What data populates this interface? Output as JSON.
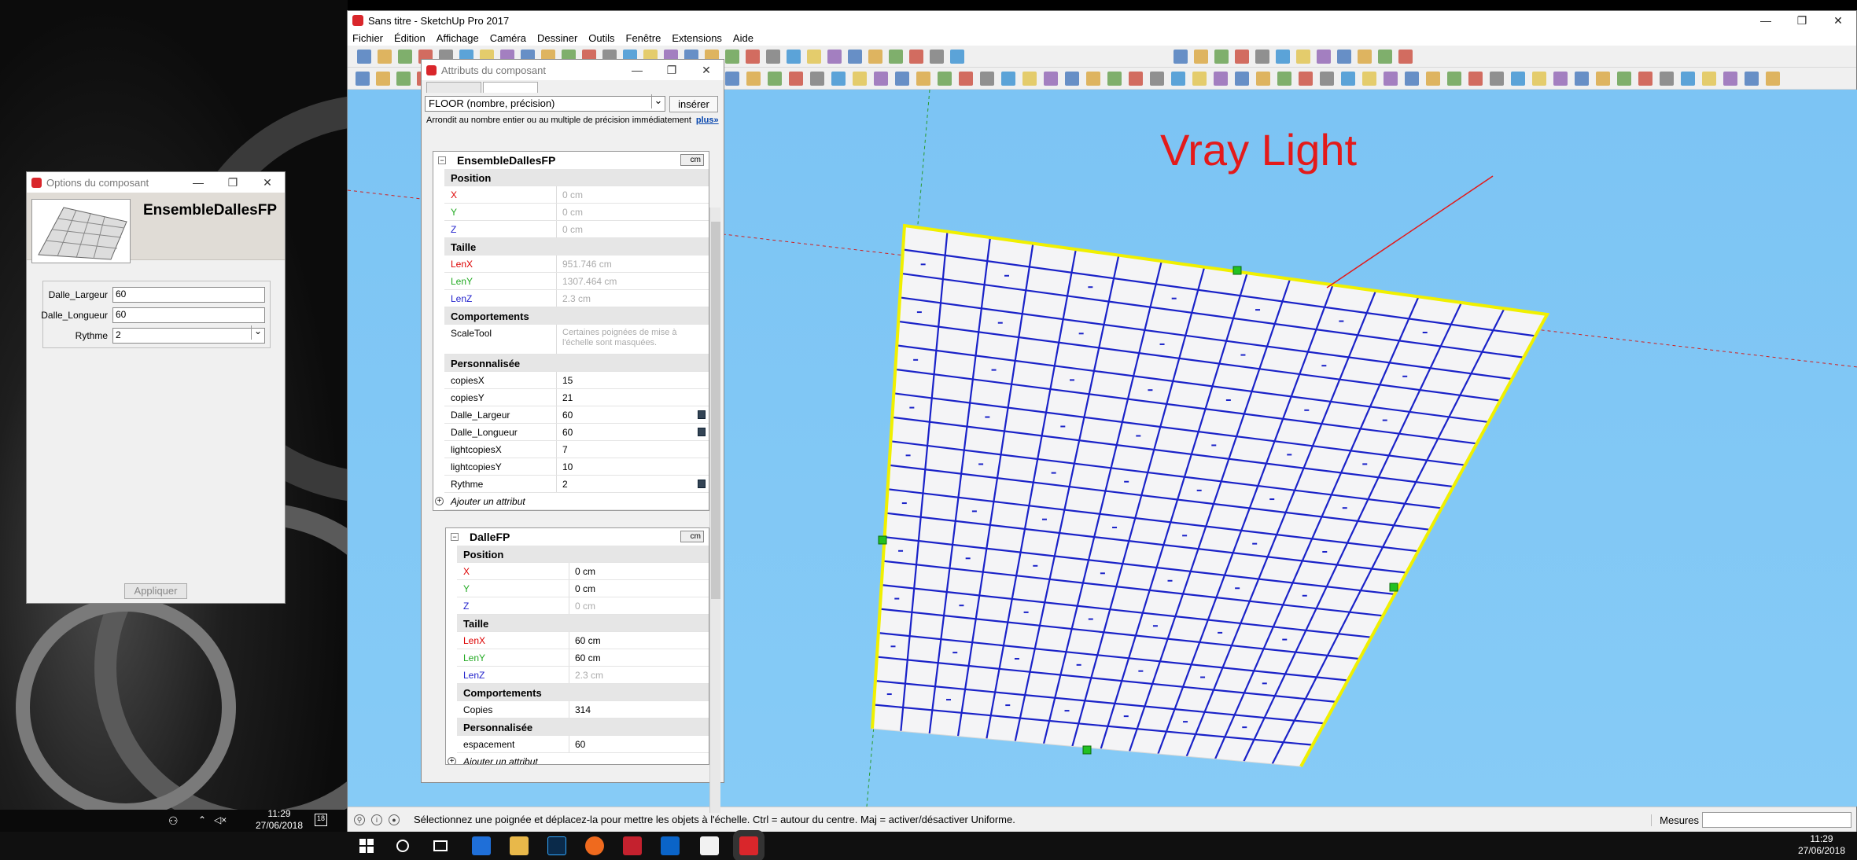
{
  "main_window": {
    "title": "Sans titre - SketchUp Pro 2017",
    "controls": {
      "minimize": "—",
      "restore": "❐",
      "close": "✕"
    },
    "menu": [
      "Fichier",
      "Édition",
      "Affichage",
      "Caméra",
      "Dessiner",
      "Outils",
      "Fenêtre",
      "Extensions",
      "Aide"
    ]
  },
  "viewport": {
    "annotation": "Vray Light",
    "colors": {
      "sky": "#7cc4f4",
      "floor": "#f4f4f6",
      "grid": "#1a22c8",
      "edge": "#f0f000",
      "red_axis": "#d02020",
      "green_axis": "#2a9a2a"
    }
  },
  "status_bar": {
    "message": "Sélectionnez une poignée et déplacez-la pour mettre les objets à l'échelle. Ctrl = autour du centre. Maj = activer/désactiver Uniforme.",
    "measure_label": "Mesures",
    "measure_value": ""
  },
  "options_dialog": {
    "title": "Options du composant",
    "component_name": "EnsembleDallesFP",
    "fields": [
      {
        "label": "Dalle_Largeur",
        "value": "60"
      },
      {
        "label": "Dalle_Longueur",
        "value": "60"
      },
      {
        "label": "Rythme",
        "value": "2"
      }
    ],
    "apply_label": "Appliquer"
  },
  "attributes_dialog": {
    "title": "Attributs du composant",
    "formula_select": "FLOOR (nombre, précision)",
    "insert_label": "insérer",
    "hint": "Arrondit au nombre entier ou au multiple de précision immédiatement",
    "hint_link": "plus»",
    "components": [
      {
        "name": "EnsembleDallesFP",
        "unit": "cm",
        "rows": [
          {
            "type": "section",
            "key": "Position"
          },
          {
            "key": "X",
            "value": "0 cm",
            "color": "red",
            "gray": true
          },
          {
            "key": "Y",
            "value": "0 cm",
            "color": "green",
            "gray": true
          },
          {
            "key": "Z",
            "value": "0 cm",
            "color": "blue",
            "gray": true
          },
          {
            "type": "section",
            "key": "Taille"
          },
          {
            "key": "LenX",
            "value": "951.746 cm",
            "color": "red",
            "gray": true
          },
          {
            "key": "LenY",
            "value": "1307.464 cm",
            "color": "green",
            "gray": true
          },
          {
            "key": "LenZ",
            "value": "2.3 cm",
            "color": "blue",
            "gray": true
          },
          {
            "type": "section",
            "key": "Comportements"
          },
          {
            "key": "ScaleTool",
            "value": "Certaines poignées de mise à l'échelle sont masquées.",
            "gray": true,
            "tall": true
          },
          {
            "type": "section",
            "key": "Personnalisée"
          },
          {
            "key": "copiesX",
            "value": "15"
          },
          {
            "key": "copiesY",
            "value": "21"
          },
          {
            "key": "Dalle_Largeur",
            "value": "60",
            "edit": true
          },
          {
            "key": "Dalle_Longueur",
            "value": "60",
            "edit": true
          },
          {
            "key": "lightcopiesX",
            "value": "7"
          },
          {
            "key": "lightcopiesY",
            "value": "10"
          },
          {
            "key": "Rythme",
            "value": "2",
            "edit": true
          },
          {
            "type": "add",
            "key": "Ajouter un attribut"
          }
        ]
      },
      {
        "name": "DalleFP",
        "unit": "cm",
        "rows": [
          {
            "type": "section",
            "key": "Position"
          },
          {
            "key": "X",
            "value": "0 cm",
            "color": "red"
          },
          {
            "key": "Y",
            "value": "0 cm",
            "color": "green"
          },
          {
            "key": "Z",
            "value": "0 cm",
            "color": "blue",
            "gray": true
          },
          {
            "type": "section",
            "key": "Taille"
          },
          {
            "key": "LenX",
            "value": "60 cm",
            "color": "red"
          },
          {
            "key": "LenY",
            "value": "60 cm",
            "color": "green"
          },
          {
            "key": "LenZ",
            "value": "2.3 cm",
            "color": "blue",
            "gray": true
          },
          {
            "type": "section",
            "key": "Comportements"
          },
          {
            "key": "Copies",
            "value": "314"
          },
          {
            "type": "section",
            "key": "Personnalisée"
          },
          {
            "key": "espacement",
            "value": "60"
          },
          {
            "type": "add",
            "key": "Ajouter un attribut"
          }
        ]
      }
    ]
  },
  "taskbar": {
    "left_clock_time": "11:29",
    "left_clock_date": "27/06/2018",
    "notification_count": "18",
    "clock_time": "11:29",
    "clock_date": "27/06/2018",
    "apps": [
      "windows-icon",
      "search-icon",
      "task-view-icon",
      "edge-icon",
      "file-explorer-icon",
      "photoshop-icon",
      "firefox-icon",
      "autocad-icon",
      "outlook-icon",
      "notes-icon",
      "sketchup-icon"
    ]
  }
}
